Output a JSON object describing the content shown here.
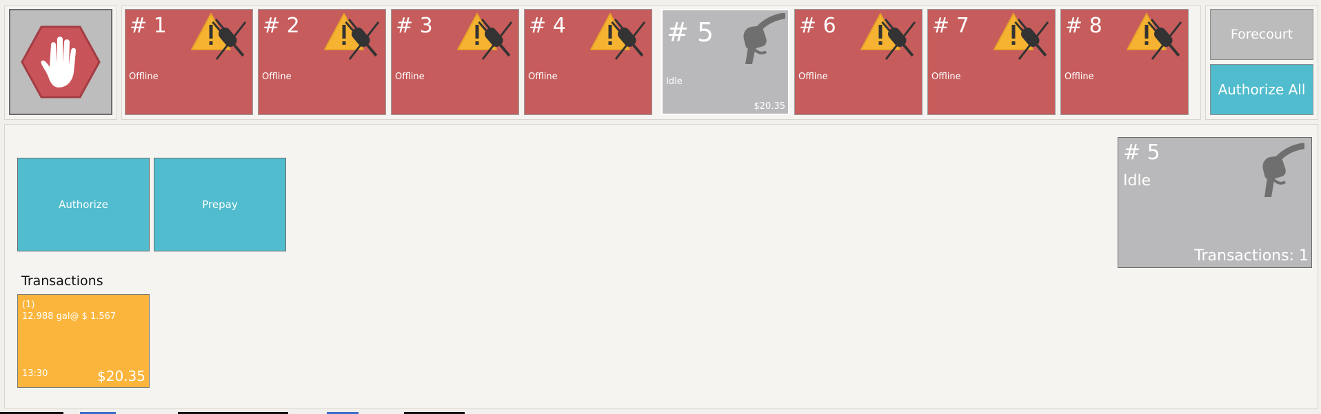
{
  "stop": {
    "icon": "stop-hand-icon"
  },
  "pumps": [
    {
      "number": "# 1",
      "status": "Offline",
      "amount": "",
      "icon": "offline-warning-icon"
    },
    {
      "number": "# 2",
      "status": "Offline",
      "amount": "",
      "icon": "offline-warning-icon"
    },
    {
      "number": "# 3",
      "status": "Offline",
      "amount": "",
      "icon": "offline-warning-icon"
    },
    {
      "number": "# 4",
      "status": "Offline",
      "amount": "",
      "icon": "offline-warning-icon"
    },
    {
      "number": "# 5",
      "status": "Idle",
      "amount": "$20.35",
      "icon": "fuel-nozzle-icon"
    },
    {
      "number": "# 6",
      "status": "Offline",
      "amount": "",
      "icon": "offline-warning-icon"
    },
    {
      "number": "# 7",
      "status": "Offline",
      "amount": "",
      "icon": "offline-warning-icon"
    },
    {
      "number": "# 8",
      "status": "Offline",
      "amount": "",
      "icon": "offline-warning-icon"
    }
  ],
  "side": {
    "forecourt_label": "Forecourt",
    "authorize_all_label": "Authorize All"
  },
  "actions": {
    "authorize_label": "Authorize",
    "prepay_label": "Prepay"
  },
  "transactions": {
    "label": "Transactions",
    "items": [
      {
        "index": "(1)",
        "quantity": "12.988 gal@ $ 1.567",
        "time": "13:30",
        "amount": "$20.35"
      }
    ]
  },
  "selected_pump": {
    "number": "# 5",
    "status": "Idle",
    "transactions": "Transactions: 1"
  },
  "colors": {
    "offline": "#c65c5c",
    "idle": "#b9b9bb",
    "accent": "#50bccd",
    "transaction": "#fbb53c",
    "warning": "#f6b331"
  }
}
